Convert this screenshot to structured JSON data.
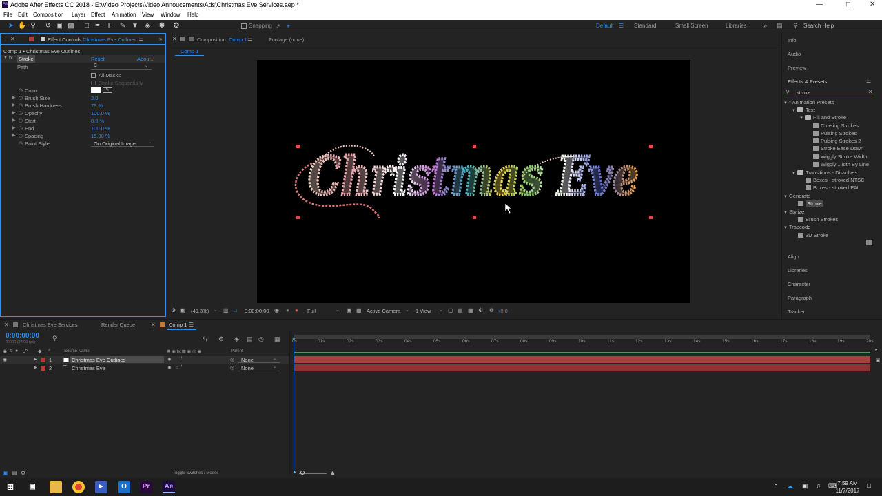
{
  "window": {
    "title": "Adobe After Effects CC 2018 - E:\\Video Projects\\Video Annoucements\\Ads\\Christmas Eve Services.aep *"
  },
  "menu": [
    "File",
    "Edit",
    "Composition",
    "Layer",
    "Effect",
    "Animation",
    "View",
    "Window",
    "Help"
  ],
  "toolbar": {
    "snapping": "Snapping",
    "workspaces": [
      "Default",
      "Standard",
      "Small Screen",
      "Libraries"
    ],
    "search_help": "Search Help"
  },
  "effect_controls": {
    "tab_label": "Effect Controls",
    "tab_target": "Christmas Eve Outlines",
    "header": "Comp 1 • Christmas Eve Outlines",
    "effect_name": "Stroke",
    "reset": "Reset",
    "about": "About...",
    "path_label": "Path",
    "path_value": "C",
    "all_masks": "All Masks",
    "stroke_sequentially": "Stroke Sequentially",
    "props": [
      {
        "label": "Color",
        "value": ""
      },
      {
        "label": "Brush Size",
        "value": "2.0"
      },
      {
        "label": "Brush Hardness",
        "value": "79 %"
      },
      {
        "label": "Opacity",
        "value": "100.0 %"
      },
      {
        "label": "Start",
        "value": "0.0 %"
      },
      {
        "label": "End",
        "value": "100.0 %"
      },
      {
        "label": "Spacing",
        "value": "15.00 %"
      },
      {
        "label": "Paint Style",
        "value": "On Original Image"
      }
    ]
  },
  "composition": {
    "tab_label": "Composition",
    "tab_name": "Comp 1",
    "footage_tab": "Footage (none)",
    "breadcrumb": "Comp 1",
    "canvas_text": "Christmas Eve",
    "zoom": "(49.3%)",
    "timecode": "0:00:00:00",
    "resolution": "Full",
    "camera": "Active Camera",
    "view": "1 View",
    "exposure": "+0.0"
  },
  "right_panel": {
    "top_items": [
      "Info",
      "Audio",
      "Preview"
    ],
    "effects_presets_title": "Effects & Presets",
    "search_value": "stroke",
    "tree": [
      {
        "label": "* Animation Presets",
        "level": 0,
        "kind": "root"
      },
      {
        "label": "Text",
        "level": 1,
        "kind": "folder"
      },
      {
        "label": "Fill and Stroke",
        "level": 2,
        "kind": "folder"
      },
      {
        "label": "Chasing Strokes",
        "level": 3,
        "kind": "item"
      },
      {
        "label": "Pulsing Strokes",
        "level": 3,
        "kind": "item"
      },
      {
        "label": "Pulsing Strokes 2",
        "level": 3,
        "kind": "item"
      },
      {
        "label": "Stroke Ease Down",
        "level": 3,
        "kind": "item"
      },
      {
        "label": "Wiggly Stroke Width",
        "level": 3,
        "kind": "item"
      },
      {
        "label": "Wiggly ...idth By Line",
        "level": 3,
        "kind": "item"
      },
      {
        "label": "Transitions - Dissolves",
        "level": 1,
        "kind": "folder"
      },
      {
        "label": "Boxes - stroked NTSC",
        "level": 2,
        "kind": "item"
      },
      {
        "label": "Boxes - stroked PAL",
        "level": 2,
        "kind": "item"
      },
      {
        "label": "Generate",
        "level": 0,
        "kind": "root"
      },
      {
        "label": "Stroke",
        "level": 1,
        "kind": "item-selected"
      },
      {
        "label": "Stylize",
        "level": 0,
        "kind": "root"
      },
      {
        "label": "Brush Strokes",
        "level": 1,
        "kind": "item"
      },
      {
        "label": "Trapcode",
        "level": 0,
        "kind": "root"
      },
      {
        "label": "3D Stroke",
        "level": 1,
        "kind": "item"
      }
    ],
    "bottom_items": [
      "Align",
      "Libraries",
      "Character",
      "Paragraph",
      "Tracker"
    ]
  },
  "timeline": {
    "tabs": [
      "Christmas Eve Services",
      "Render Queue",
      "Comp 1"
    ],
    "timecode": "0:00:00:00",
    "frame_info": "00000 (24.00 fps)",
    "col_source_name": "Source Name",
    "col_parent": "Parent",
    "col_hash": "#",
    "layers": [
      {
        "num": "1",
        "name": "Christmas Eve Outlines",
        "parent": "None",
        "type": "solid"
      },
      {
        "num": "2",
        "name": "Christmas Eve",
        "parent": "None",
        "type": "text"
      }
    ],
    "ruler": [
      "0s",
      "01s",
      "02s",
      "03s",
      "04s",
      "05s",
      "06s",
      "07s",
      "08s",
      "09s",
      "10s",
      "11s",
      "12s",
      "13s",
      "14s",
      "15s",
      "16s",
      "17s",
      "18s",
      "19s",
      "20s"
    ],
    "toggle_label": "Toggle Switches / Modes"
  },
  "taskbar": {
    "time": "7:59 AM",
    "date": "11/7/2017"
  },
  "colors": {
    "accent": "#2f8df5",
    "label_red": "#b7383a",
    "layer_bar": "#a8403f"
  }
}
